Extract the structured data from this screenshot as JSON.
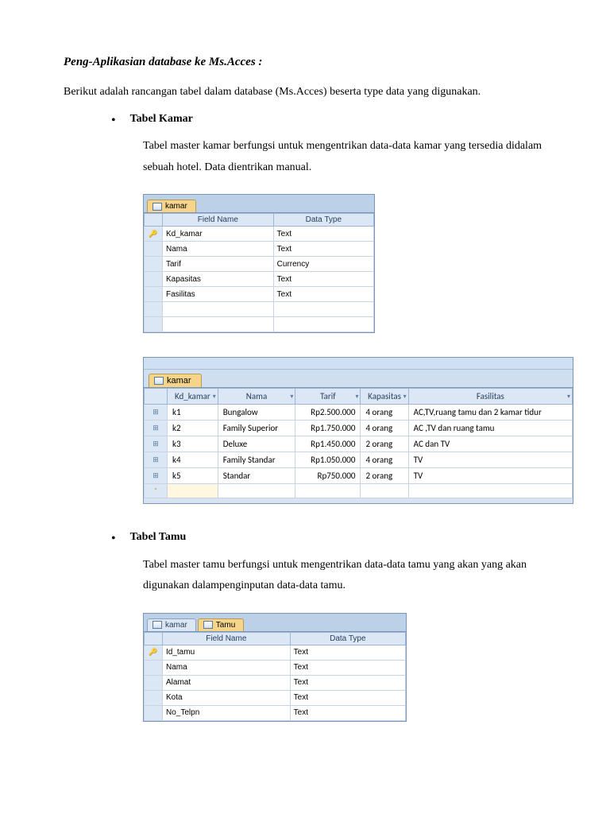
{
  "title": "Peng-Aplikasian database ke Ms.Acces :",
  "intro": "Berikut adalah rancangan tabel dalam database (Ms.Acces) beserta type data yang digunakan.",
  "section1": {
    "heading": "Tabel  Kamar",
    "desc": "Tabel  master kamar berfungsi untuk mengentrikan data-data kamar yang tersedia didalam sebuah hotel. Data dientrikan manual."
  },
  "designKamar": {
    "tab": "kamar",
    "headers": {
      "field": "Field Name",
      "type": "Data Type"
    },
    "rows": [
      {
        "pk": true,
        "field": "Kd_kamar",
        "type": "Text"
      },
      {
        "pk": false,
        "field": "Nama",
        "type": "Text"
      },
      {
        "pk": false,
        "field": "Tarif",
        "type": "Currency"
      },
      {
        "pk": false,
        "field": "Kapasitas",
        "type": "Text"
      },
      {
        "pk": false,
        "field": "Fasilitas",
        "type": "Text"
      }
    ]
  },
  "dataKamar": {
    "tab": "kamar",
    "headers": [
      "Kd_kamar",
      "Nama",
      "Tarif",
      "Kapasitas",
      "Fasilitas"
    ],
    "rows": [
      {
        "kd": "k1",
        "nama": "Bungalow",
        "tarif": "Rp2.500.000",
        "kap": "4 orang",
        "fas": "AC,TV,ruang tamu dan 2 kamar tidur"
      },
      {
        "kd": "k2",
        "nama": "Family Superior",
        "tarif": "Rp1.750.000",
        "kap": "4 orang",
        "fas": "AC ,TV dan ruang tamu"
      },
      {
        "kd": "k3",
        "nama": "Deluxe",
        "tarif": "Rp1.450.000",
        "kap": "2 orang",
        "fas": "AC dan TV"
      },
      {
        "kd": "k4",
        "nama": "Family Standar",
        "tarif": "Rp1.050.000",
        "kap": "4 orang",
        "fas": "TV"
      },
      {
        "kd": "k5",
        "nama": "Standar",
        "tarif": "Rp750.000",
        "kap": "2 orang",
        "fas": "TV"
      }
    ]
  },
  "section2": {
    "heading": "Tabel Tamu",
    "desc": "Tabel  master tamu  berfungsi untuk mengentrikan data-data tamu yang akan yang akan digunakan dalampenginputan data-data tamu."
  },
  "designTamu": {
    "tab1": "kamar",
    "tab2": "Tamu",
    "headers": {
      "field": "Field Name",
      "type": "Data Type"
    },
    "rows": [
      {
        "pk": true,
        "field": "Id_tamu",
        "type": "Text"
      },
      {
        "pk": false,
        "field": "Nama",
        "type": "Text"
      },
      {
        "pk": false,
        "field": "Alamat",
        "type": "Text"
      },
      {
        "pk": false,
        "field": "Kota",
        "type": "Text"
      },
      {
        "pk": false,
        "field": "No_Telpn",
        "type": "Text"
      }
    ]
  }
}
